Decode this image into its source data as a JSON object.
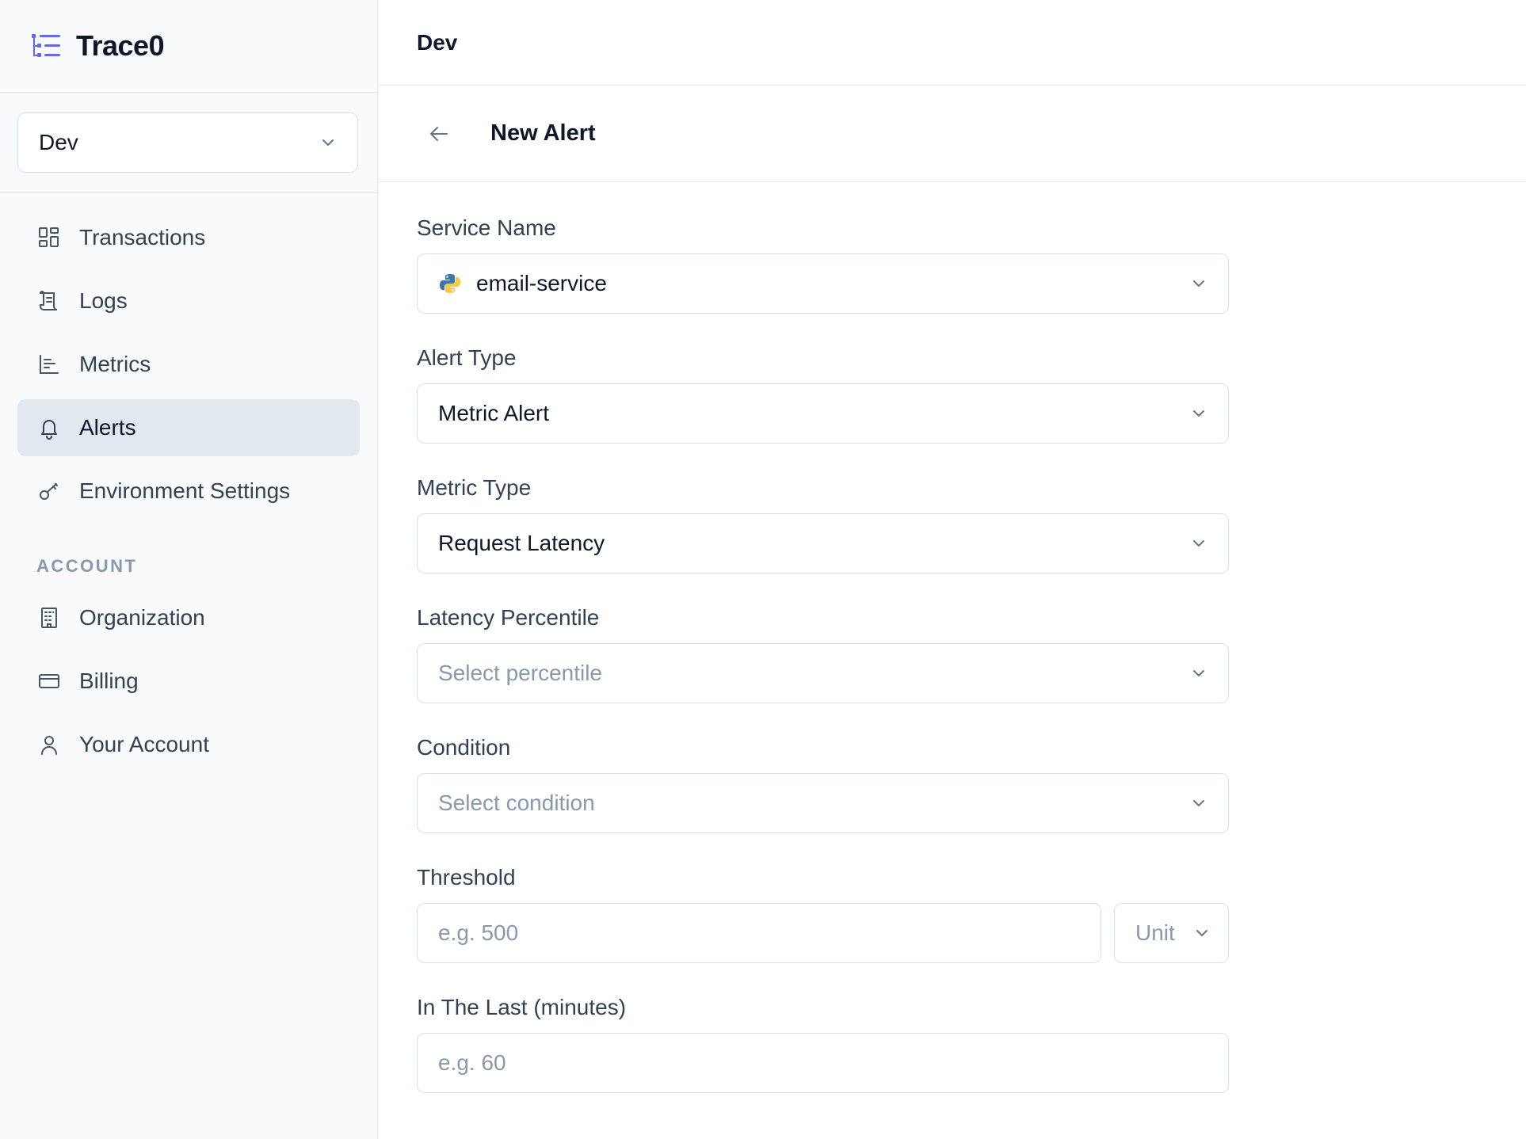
{
  "app": {
    "brand": "Trace0"
  },
  "sidebar": {
    "environment": "Dev",
    "nav": [
      {
        "label": "Transactions",
        "icon": "grid-icon"
      },
      {
        "label": "Logs",
        "icon": "scroll-icon"
      },
      {
        "label": "Metrics",
        "icon": "bar-chart-icon"
      },
      {
        "label": "Alerts",
        "icon": "bell-icon",
        "active": true
      },
      {
        "label": "Environment Settings",
        "icon": "key-icon"
      }
    ],
    "account_section_title": "ACCOUNT",
    "account": [
      {
        "label": "Organization",
        "icon": "building-icon"
      },
      {
        "label": "Billing",
        "icon": "credit-card-icon"
      },
      {
        "label": "Your Account",
        "icon": "user-icon"
      }
    ]
  },
  "topbar": {
    "title": "Dev"
  },
  "page": {
    "title": "New Alert"
  },
  "form": {
    "service_name": {
      "label": "Service Name",
      "value": "email-service"
    },
    "alert_type": {
      "label": "Alert Type",
      "value": "Metric Alert"
    },
    "metric_type": {
      "label": "Metric Type",
      "value": "Request Latency"
    },
    "latency_percentile": {
      "label": "Latency Percentile",
      "placeholder": "Select percentile"
    },
    "condition": {
      "label": "Condition",
      "placeholder": "Select condition"
    },
    "threshold": {
      "label": "Threshold",
      "placeholder": "e.g. 500",
      "unit_placeholder": "Unit"
    },
    "in_the_last": {
      "label": "In The Last (minutes)",
      "placeholder": "e.g. 60"
    }
  },
  "colors": {
    "accent": "#6366f1",
    "sidebar_bg": "#f8fafc",
    "active_nav_bg": "#e2e8f0",
    "placeholder": "#8a98ad",
    "border": "#d9e0ea"
  }
}
